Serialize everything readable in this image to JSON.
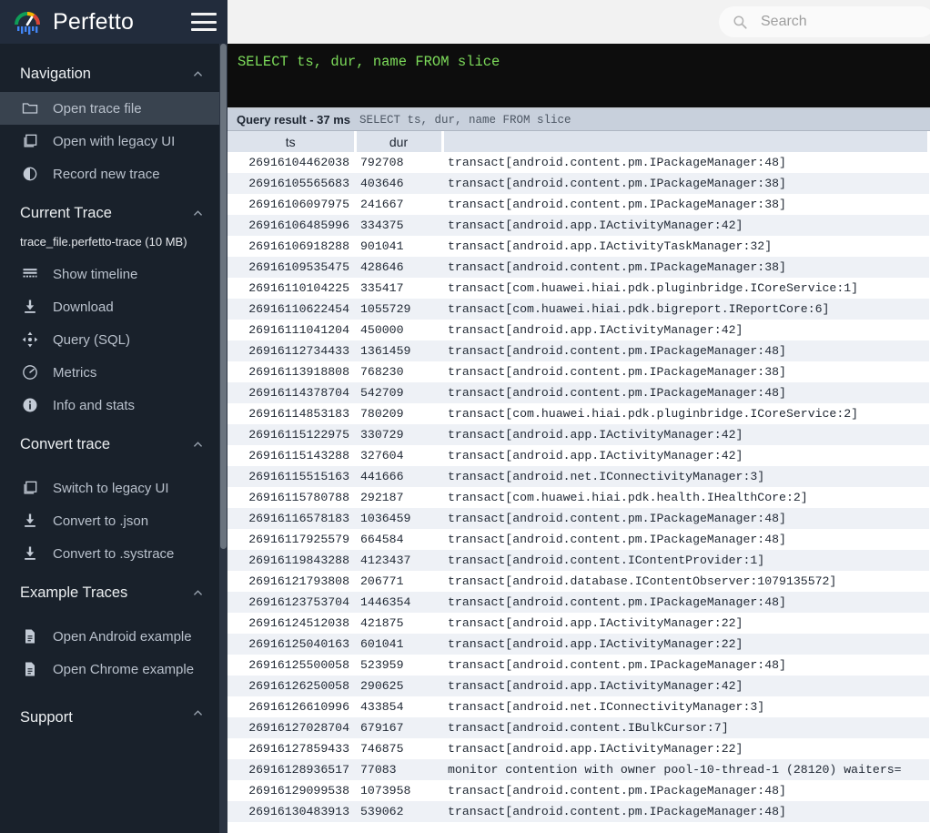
{
  "brand": {
    "name": "Perfetto",
    "logo_icon": "perfetto-gauge-logo",
    "menu_icon": "hamburger-menu-icon"
  },
  "topbar": {
    "search": {
      "placeholder": "Search",
      "value": "",
      "icon": "search-icon"
    }
  },
  "sidebar": {
    "sections": [
      {
        "title": "Navigation",
        "collapse_icon": "chevron-up-icon",
        "items": [
          {
            "label": "Open trace file",
            "icon": "folder-icon",
            "active": true
          },
          {
            "label": "Open with legacy UI",
            "icon": "copy-icon",
            "active": false
          },
          {
            "label": "Record new trace",
            "icon": "record-circle-icon",
            "active": false
          }
        ]
      },
      {
        "title": "Current Trace",
        "collapse_icon": "chevron-up-icon",
        "filename": "trace_file.perfetto-trace (10 MB)",
        "items": [
          {
            "label": "Show timeline",
            "icon": "timeline-icon",
            "active": false
          },
          {
            "label": "Download",
            "icon": "download-icon",
            "active": false
          },
          {
            "label": "Query (SQL)",
            "icon": "query-sql-icon",
            "active": false
          },
          {
            "label": "Metrics",
            "icon": "speedometer-icon",
            "active": false
          },
          {
            "label": "Info and stats",
            "icon": "info-icon",
            "active": false
          }
        ]
      },
      {
        "title": "Convert trace",
        "collapse_icon": "chevron-up-icon",
        "items": [
          {
            "label": "Switch to legacy UI",
            "icon": "copy-icon",
            "active": false
          },
          {
            "label": "Convert to .json",
            "icon": "download-icon",
            "active": false
          },
          {
            "label": "Convert to .systrace",
            "icon": "download-icon",
            "active": false
          }
        ]
      },
      {
        "title": "Example Traces",
        "collapse_icon": "chevron-up-icon",
        "items": [
          {
            "label": "Open Android example",
            "icon": "file-document-icon",
            "active": false
          },
          {
            "label": "Open Chrome example",
            "icon": "file-document-icon",
            "active": false
          }
        ]
      },
      {
        "title": "Support",
        "collapse_icon": "chevron-up-icon",
        "items": []
      }
    ]
  },
  "query_editor": {
    "text": "SELECT ts, dur, name FROM slice"
  },
  "result_header": {
    "title": "Query result - 37 ms",
    "query": "SELECT ts, dur, name FROM slice"
  },
  "result_table": {
    "columns": [
      "ts",
      "dur",
      ""
    ],
    "rows": [
      [
        "26916104462038",
        "792708",
        "transact[android.content.pm.IPackageManager:48]"
      ],
      [
        "26916105565683",
        "403646",
        "transact[android.content.pm.IPackageManager:38]"
      ],
      [
        "26916106097975",
        "241667",
        "transact[android.content.pm.IPackageManager:38]"
      ],
      [
        "26916106485996",
        "334375",
        "transact[android.app.IActivityManager:42]"
      ],
      [
        "26916106918288",
        "901041",
        "transact[android.app.IActivityTaskManager:32]"
      ],
      [
        "26916109535475",
        "428646",
        "transact[android.content.pm.IPackageManager:38]"
      ],
      [
        "26916110104225",
        "335417",
        "transact[com.huawei.hiai.pdk.pluginbridge.ICoreService:1]"
      ],
      [
        "26916110622454",
        "1055729",
        "transact[com.huawei.hiai.pdk.bigreport.IReportCore:6]"
      ],
      [
        "26916111041204",
        "450000",
        "transact[android.app.IActivityManager:42]"
      ],
      [
        "26916112734433",
        "1361459",
        "transact[android.content.pm.IPackageManager:48]"
      ],
      [
        "26916113918808",
        "768230",
        "transact[android.content.pm.IPackageManager:38]"
      ],
      [
        "26916114378704",
        "542709",
        "transact[android.content.pm.IPackageManager:48]"
      ],
      [
        "26916114853183",
        "780209",
        "transact[com.huawei.hiai.pdk.pluginbridge.ICoreService:2]"
      ],
      [
        "26916115122975",
        "330729",
        "transact[android.app.IActivityManager:42]"
      ],
      [
        "26916115143288",
        "327604",
        "transact[android.app.IActivityManager:42]"
      ],
      [
        "26916115515163",
        "441666",
        "transact[android.net.IConnectivityManager:3]"
      ],
      [
        "26916115780788",
        "292187",
        "transact[com.huawei.hiai.pdk.health.IHealthCore:2]"
      ],
      [
        "26916116578183",
        "1036459",
        "transact[android.content.pm.IPackageManager:48]"
      ],
      [
        "26916117925579",
        "664584",
        "transact[android.content.pm.IPackageManager:48]"
      ],
      [
        "26916119843288",
        "4123437",
        "transact[android.content.IContentProvider:1]"
      ],
      [
        "26916121793808",
        "206771",
        "transact[android.database.IContentObserver:1079135572]"
      ],
      [
        "26916123753704",
        "1446354",
        "transact[android.content.pm.IPackageManager:48]"
      ],
      [
        "26916124512038",
        "421875",
        "transact[android.app.IActivityManager:22]"
      ],
      [
        "26916125040163",
        "601041",
        "transact[android.app.IActivityManager:22]"
      ],
      [
        "26916125500058",
        "523959",
        "transact[android.content.pm.IPackageManager:48]"
      ],
      [
        "26916126250058",
        "290625",
        "transact[android.app.IActivityManager:42]"
      ],
      [
        "26916126610996",
        "433854",
        "transact[android.net.IConnectivityManager:3]"
      ],
      [
        "26916127028704",
        "679167",
        "transact[android.content.IBulkCursor:7]"
      ],
      [
        "26916127859433",
        "746875",
        "transact[android.app.IActivityManager:22]"
      ],
      [
        "26916128936517",
        "77083",
        "monitor contention with owner pool-10-thread-1 (28120) waiters="
      ],
      [
        "26916129099538",
        "1073958",
        "transact[android.content.pm.IPackageManager:48]"
      ],
      [
        "26916130483913",
        "539062",
        "transact[android.content.pm.IPackageManager:48]"
      ]
    ]
  },
  "colors": {
    "sidebar_bg": "#19212b",
    "sidebar_header_bg": "#222c3c",
    "sidebar_active": "#39434f",
    "editor_bg": "#0d0d0d",
    "editor_text": "#7ddc5a",
    "result_header_bg": "#c8d0dc",
    "table_header_bg": "#dde3ec",
    "row_alt_bg": "#eef1f6"
  }
}
